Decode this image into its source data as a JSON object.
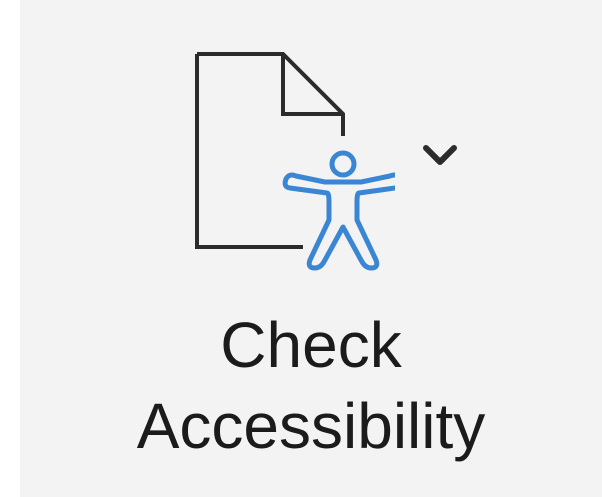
{
  "button": {
    "label_line1": "Check",
    "label_line2": "Accessibility",
    "icon": "document-accessibility-icon",
    "dropdown_icon": "chevron-down-icon",
    "accent_color": "#3b86d4",
    "outline_color": "#2b2b2b"
  }
}
